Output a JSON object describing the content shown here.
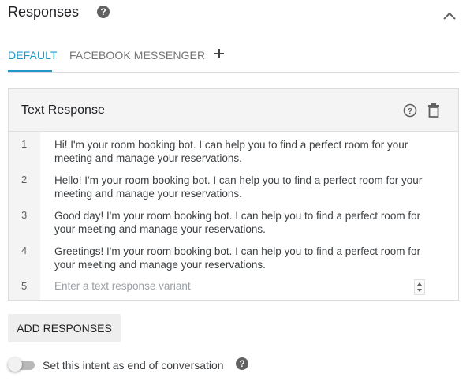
{
  "header": {
    "title": "Responses",
    "help_icon": "help-circle-icon",
    "collapse_icon": "chevron-up-icon"
  },
  "tabs": [
    {
      "label": "DEFAULT",
      "active": true
    },
    {
      "label": "FACEBOOK MESSENGER",
      "active": false
    }
  ],
  "add_tab_icon": "plus-icon",
  "text_response": {
    "title": "Text Response",
    "help_icon": "help-outline-icon",
    "delete_icon": "trash-icon",
    "rows": [
      {
        "num": "1",
        "text": "Hi! I'm your room booking bot. I can help you to find a perfect room for your meeting and manage your reservations."
      },
      {
        "num": "2",
        "text": "Hello! I'm your room booking bot. I can help you to find a perfect room for your meeting and manage your reservations."
      },
      {
        "num": "3",
        "text": "Good day! I'm your room booking bot. I can help you to find a perfect room for your meeting and manage your reservations."
      },
      {
        "num": "4",
        "text": "Greetings! I'm your room booking bot. I can help you to find a perfect room for your meeting and manage your reservations."
      }
    ],
    "new_row_num": "5",
    "placeholder": "Enter a text response variant"
  },
  "add_responses_label": "ADD RESPONSES",
  "end_conversation": {
    "label": "Set this intent as end of conversation",
    "enabled": false
  },
  "colors": {
    "accent": "#2196c9",
    "header_bg": "#f4f4f4",
    "border": "#dadce0"
  }
}
